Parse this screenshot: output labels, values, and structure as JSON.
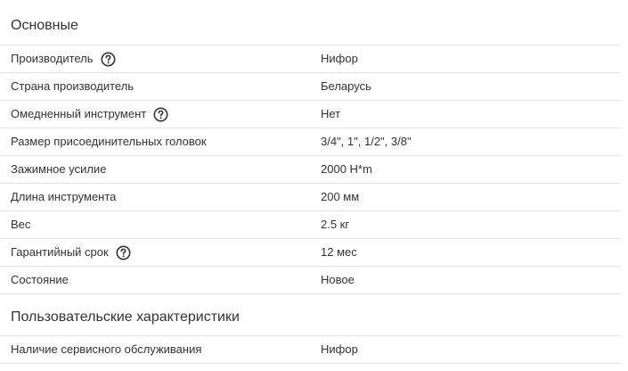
{
  "sections": [
    {
      "title": "Основные",
      "rows": [
        {
          "name": "Производитель",
          "value": "Нифор",
          "help": true
        },
        {
          "name": "Страна производитель",
          "value": "Беларусь",
          "help": false
        },
        {
          "name": "Омедненный инструмент",
          "value": "Нет",
          "help": true
        },
        {
          "name": "Размер присоединительных головок",
          "value": "3/4\", 1\", 1/2\", 3/8\"",
          "help": false
        },
        {
          "name": "Зажимное усилие",
          "value": "2000 Н*m",
          "help": false
        },
        {
          "name": "Длина инструмента",
          "value": "200 мм",
          "help": false
        },
        {
          "name": "Вес",
          "value": "2.5 кг",
          "help": false
        },
        {
          "name": "Гарантийный срок",
          "value": "12 мес",
          "help": true
        },
        {
          "name": "Состояние",
          "value": "Новое",
          "help": false
        }
      ]
    },
    {
      "title": "Пользовательские характеристики",
      "rows": [
        {
          "name": "Наличие сервисного обслуживания",
          "value": "Нифор",
          "help": false
        }
      ]
    }
  ],
  "icons": {
    "help": "question-mark-circle-icon"
  },
  "colors": {
    "text": "#333333",
    "divider": "#e3e3e3",
    "icon": "#333333"
  }
}
